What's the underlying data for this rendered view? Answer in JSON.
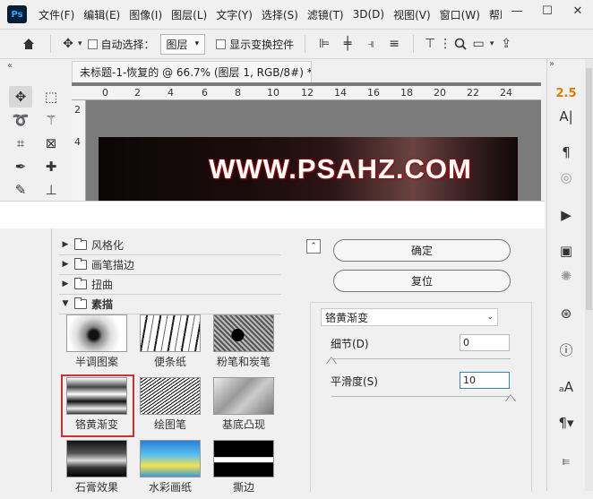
{
  "app": {
    "logo": "Ps"
  },
  "menu": [
    "文件(F)",
    "编辑(E)",
    "图像(I)",
    "图层(L)",
    "文字(Y)",
    "选择(S)",
    "滤镜(T)",
    "3D(D)",
    "视图(V)",
    "窗口(W)",
    "帮助"
  ],
  "window_controls": {
    "minimize": "—",
    "restore": "☐",
    "close": "✕"
  },
  "options_bar": {
    "auto_select_label": "自动选择：",
    "auto_select_value": "图层",
    "show_transform_label": "显示变换控件"
  },
  "document": {
    "tab_title": "未标题-1-恢复的 @ 66.7% (图层 1, RGB/8#) *",
    "ruler_top": [
      "0",
      "2",
      "4",
      "6",
      "8",
      "10",
      "12",
      "14",
      "16",
      "18",
      "20",
      "22",
      "24"
    ],
    "ruler_left": [
      "2",
      "4"
    ],
    "canvas_text": "WWW.PSAHZ.COM"
  },
  "right_panel": {
    "value_label": "2.5"
  },
  "filter_gallery": {
    "categories": [
      {
        "name": "风格化",
        "expanded": false
      },
      {
        "name": "画笔描边",
        "expanded": false
      },
      {
        "name": "扭曲",
        "expanded": false
      },
      {
        "name": "素描",
        "expanded": true
      }
    ],
    "thumbnails": [
      {
        "label": "半调图案",
        "selected": false
      },
      {
        "label": "便条纸",
        "selected": false
      },
      {
        "label": "粉笔和炭笔",
        "selected": false
      },
      {
        "label": "铬黄渐变",
        "selected": true
      },
      {
        "label": "绘图笔",
        "selected": false
      },
      {
        "label": "基底凸现",
        "selected": false
      },
      {
        "label": "石膏效果",
        "selected": false
      },
      {
        "label": "水彩画纸",
        "selected": false
      },
      {
        "label": "撕边",
        "selected": false
      }
    ],
    "ok_label": "确定",
    "reset_label": "复位",
    "selected_filter": "铬黄渐变",
    "params": {
      "detail_label": "细节(D)",
      "detail_value": "0",
      "detail_level": 0.0,
      "smoothness_label": "平滑度(S)",
      "smoothness_value": "10",
      "smoothness_level": 1.0
    }
  },
  "colors": {
    "accent_red": "#d03030",
    "active_border": "#3b7fd6",
    "ps_blue": "#31a8ff",
    "ps_dark": "#001e36",
    "value_orange": "#e07b00"
  }
}
